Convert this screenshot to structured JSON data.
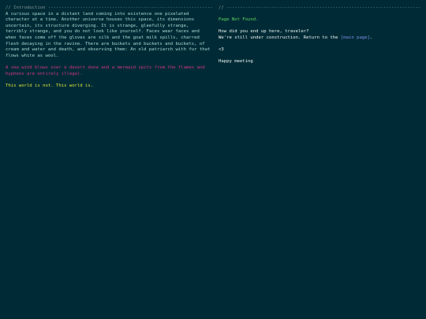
{
  "left_column": {
    "header": "// Introduction -----------------------------------------------------------------",
    "intro_paragraph": "A curious space in a distant land coming into existence one pixelated character at a time. Another universe houses this space, its dimensions uncertain, its structure diverging. It is strange, gleefully strange, terribly strange, and you do not look like yourself. Faces wear faces and when faces come off the gloves are silk and the goat milk spills, charred flesh decaying in the ravine. There are buckets and buckets and buckets, of cream and water and death, and observing them: An old patriarch with fur that flows white as wool.",
    "pink_paragraph": "A sea wind blows over a desert dune and a mermaid spits from the flames and hyphens are entirely illegal.",
    "yellow_line": "This world is not. This world is."
  },
  "right_column": {
    "header": "// ---------------------------------------------------------------------------------",
    "not_found": "Page Not Found.",
    "question": "How did you end up here, traveler?",
    "construction_prefix": "We're still under construction. Return to the ",
    "main_page_link": "[main page]",
    "construction_suffix": ".",
    "heart": "<3",
    "sign_off": "Happy meeting"
  },
  "colors": {
    "background": "#002b36",
    "header": "#839496",
    "intro_text": "#a9d8d0",
    "pink_text": "#d33682",
    "yellow_text": "#dbe33a",
    "green_text": "#5fd35f",
    "link": "#7c8fe6"
  }
}
